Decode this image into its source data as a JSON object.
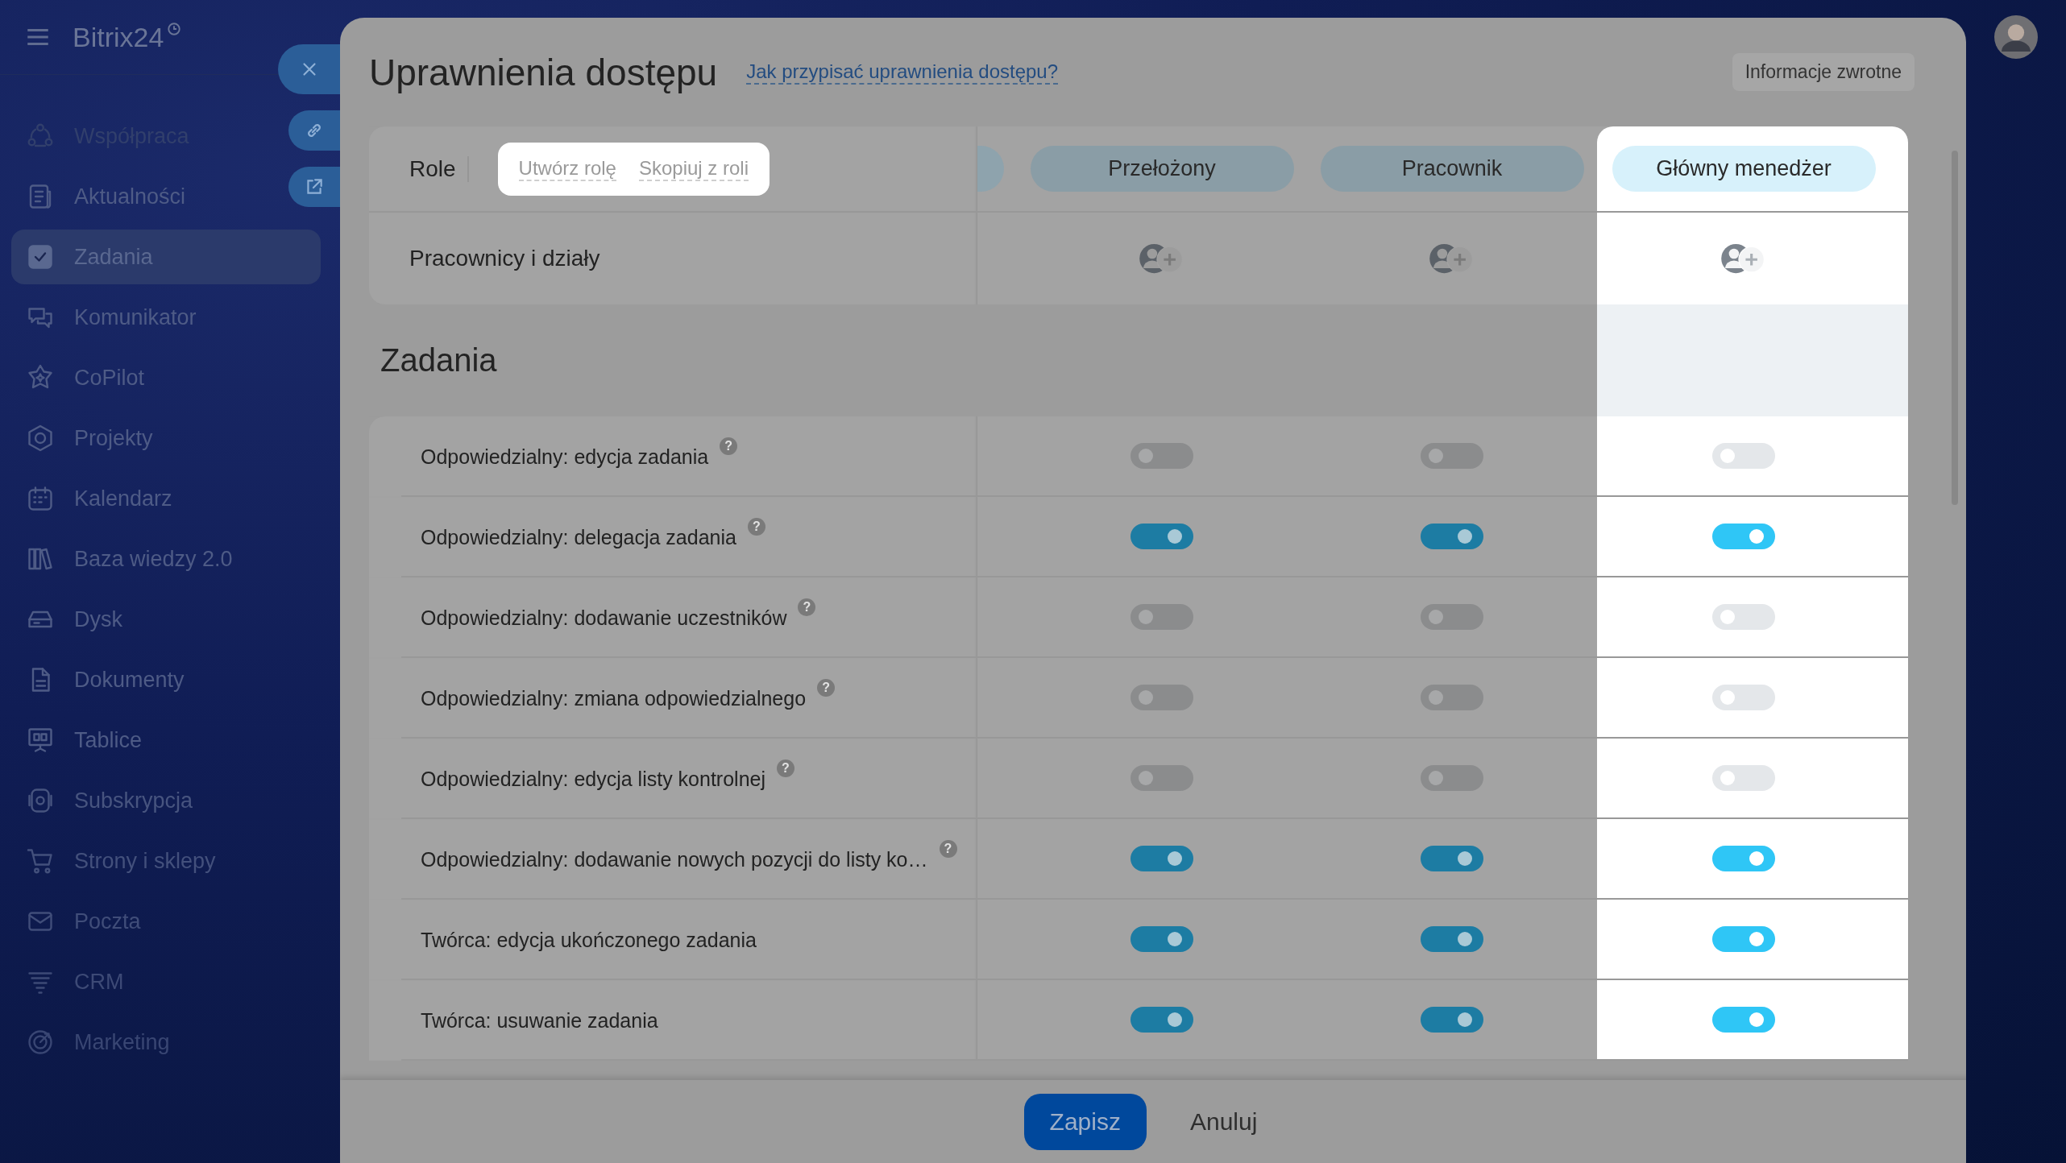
{
  "sidebar": {
    "logo": "Bitrix24",
    "items": [
      {
        "label": "Współpraca",
        "selected": false
      },
      {
        "label": "Aktualności",
        "selected": false
      },
      {
        "label": "Zadania",
        "selected": true
      },
      {
        "label": "Komunikator",
        "selected": false
      },
      {
        "label": "CoPilot",
        "selected": false
      },
      {
        "label": "Projekty",
        "selected": false
      },
      {
        "label": "Kalendarz",
        "selected": false
      },
      {
        "label": "Baza wiedzy 2.0",
        "selected": false
      },
      {
        "label": "Dysk",
        "selected": false
      },
      {
        "label": "Dokumenty",
        "selected": false
      },
      {
        "label": "Tablice",
        "selected": false
      },
      {
        "label": "Subskrypcja",
        "selected": false
      },
      {
        "label": "Strony i sklepy",
        "selected": false
      },
      {
        "label": "Poczta",
        "selected": false
      },
      {
        "label": "CRM",
        "selected": false
      },
      {
        "label": "Marketing",
        "selected": false
      }
    ]
  },
  "page": {
    "title": "Uprawnienia dostępu",
    "help_link": "Jak przypisać uprawnienia dostępu?",
    "feedback_button": "Informacje zwrotne"
  },
  "roles_header": {
    "label": "Role",
    "actions": [
      "Utwórz rolę",
      "Skopiuj z roli"
    ],
    "highlighted": true
  },
  "roles": [
    {
      "name": "Przełożony",
      "highlighted": false
    },
    {
      "name": "Pracownik",
      "highlighted": false
    },
    {
      "name": "Główny menedżer",
      "highlighted": true
    }
  ],
  "members_row": {
    "label": "Pracownicy i działy"
  },
  "section": {
    "title": "Zadania"
  },
  "permissions": [
    {
      "label": "Odpowiedzialny: edycja zadania",
      "hint": "?",
      "values": [
        {
          "on": false
        },
        {
          "on": false
        },
        {
          "on": false
        }
      ]
    },
    {
      "label": "Odpowiedzialny: delegacja zadania",
      "hint": "?",
      "values": [
        {
          "on": true
        },
        {
          "on": true
        },
        {
          "on": true
        }
      ]
    },
    {
      "label": "Odpowiedzialny: dodawanie uczestników",
      "hint": "?",
      "values": [
        {
          "on": false
        },
        {
          "on": false
        },
        {
          "on": false
        }
      ]
    },
    {
      "label": "Odpowiedzialny: zmiana odpowiedzialnego",
      "hint": "?",
      "values": [
        {
          "on": false
        },
        {
          "on": false
        },
        {
          "on": false
        }
      ]
    },
    {
      "label": "Odpowiedzialny: edycja listy kontrolnej",
      "hint": "?",
      "values": [
        {
          "on": false
        },
        {
          "on": false
        },
        {
          "on": false
        }
      ]
    },
    {
      "label": "Odpowiedzialny: dodawanie nowych pozycji do listy ko…",
      "hint": "?",
      "values": [
        {
          "on": true
        },
        {
          "on": true
        },
        {
          "on": true
        }
      ]
    },
    {
      "label": "Twórca: edycja ukończonego zadania",
      "values": [
        {
          "on": true
        },
        {
          "on": true
        },
        {
          "on": true
        }
      ]
    },
    {
      "label": "Twórca: usuwanie zadania",
      "values": [
        {
          "on": true
        },
        {
          "on": true
        },
        {
          "on": true
        }
      ]
    }
  ],
  "footer": {
    "buttons": [
      {
        "label": "Zapisz",
        "kind": "primary"
      },
      {
        "label": "Anuluj",
        "kind": "plain"
      }
    ]
  }
}
